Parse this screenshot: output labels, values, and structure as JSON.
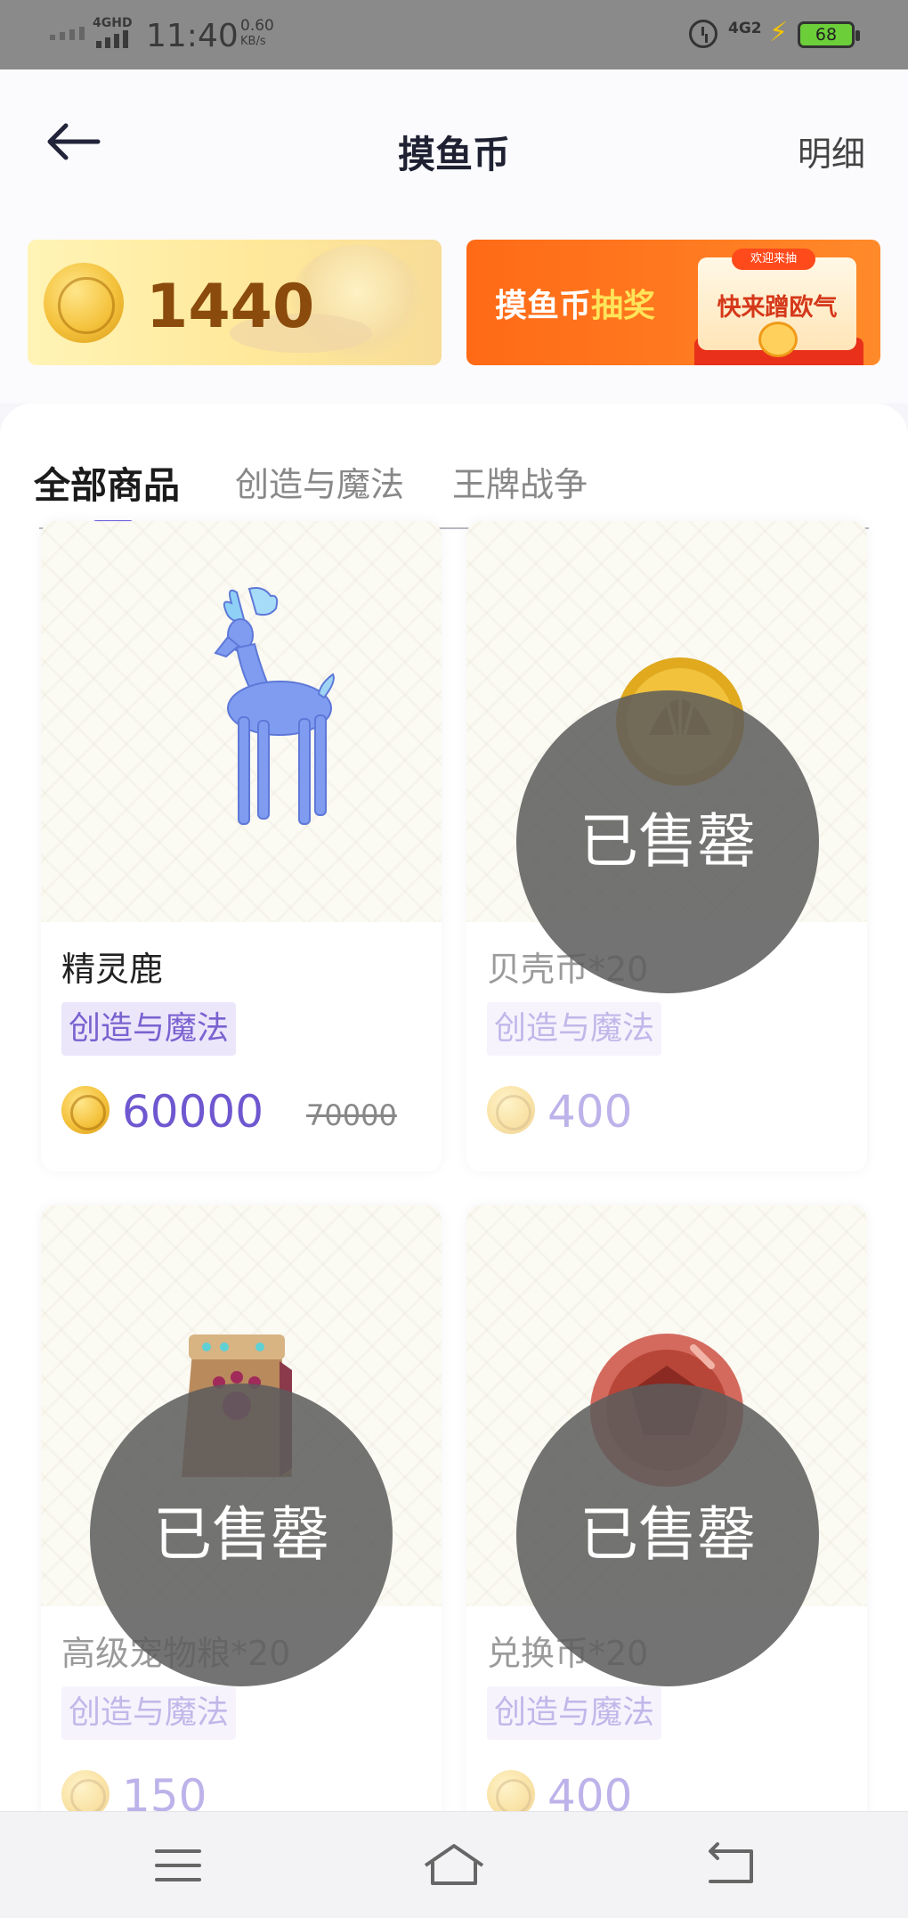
{
  "status_bar": {
    "network": "4GHD",
    "time": "11:40",
    "speed_value": "0.60",
    "speed_unit": "KB/s",
    "network_right": "4G2",
    "battery": "68"
  },
  "header": {
    "title": "摸鱼币",
    "detail_label": "明细"
  },
  "balance": {
    "amount": "1440"
  },
  "lottery_banner": {
    "text_part1": "摸鱼币",
    "text_part2": "抽奖",
    "tag": "欢迎来抽",
    "card_text": "快来蹭欧气"
  },
  "tabs": [
    {
      "label": "全部商品",
      "active": true
    },
    {
      "label": "创造与魔法",
      "active": false
    },
    {
      "label": "王牌战争",
      "active": false
    }
  ],
  "products": [
    {
      "name": "精灵鹿",
      "tag": "创造与魔法",
      "price": "60000",
      "original_price": "70000",
      "sold_out": false
    },
    {
      "name": "贝壳币*20",
      "tag": "创造与魔法",
      "price": "400",
      "sold_out": true,
      "sold_out_label": "已售罄"
    },
    {
      "name": "高级宠物粮*20",
      "tag": "创造与魔法",
      "price": "150",
      "sold_out": true,
      "sold_out_label": "已售罄"
    },
    {
      "name": "兑换币*20",
      "tag": "创造与魔法",
      "price": "400",
      "sold_out": true,
      "sold_out_label": "已售罄"
    }
  ],
  "colors": {
    "accent": "#6a5ae0",
    "price": "#6f57d0",
    "tag_bg": "#ece6fb",
    "coin_gold": "#f4c23c",
    "lottery_orange": "#ff6a16"
  }
}
